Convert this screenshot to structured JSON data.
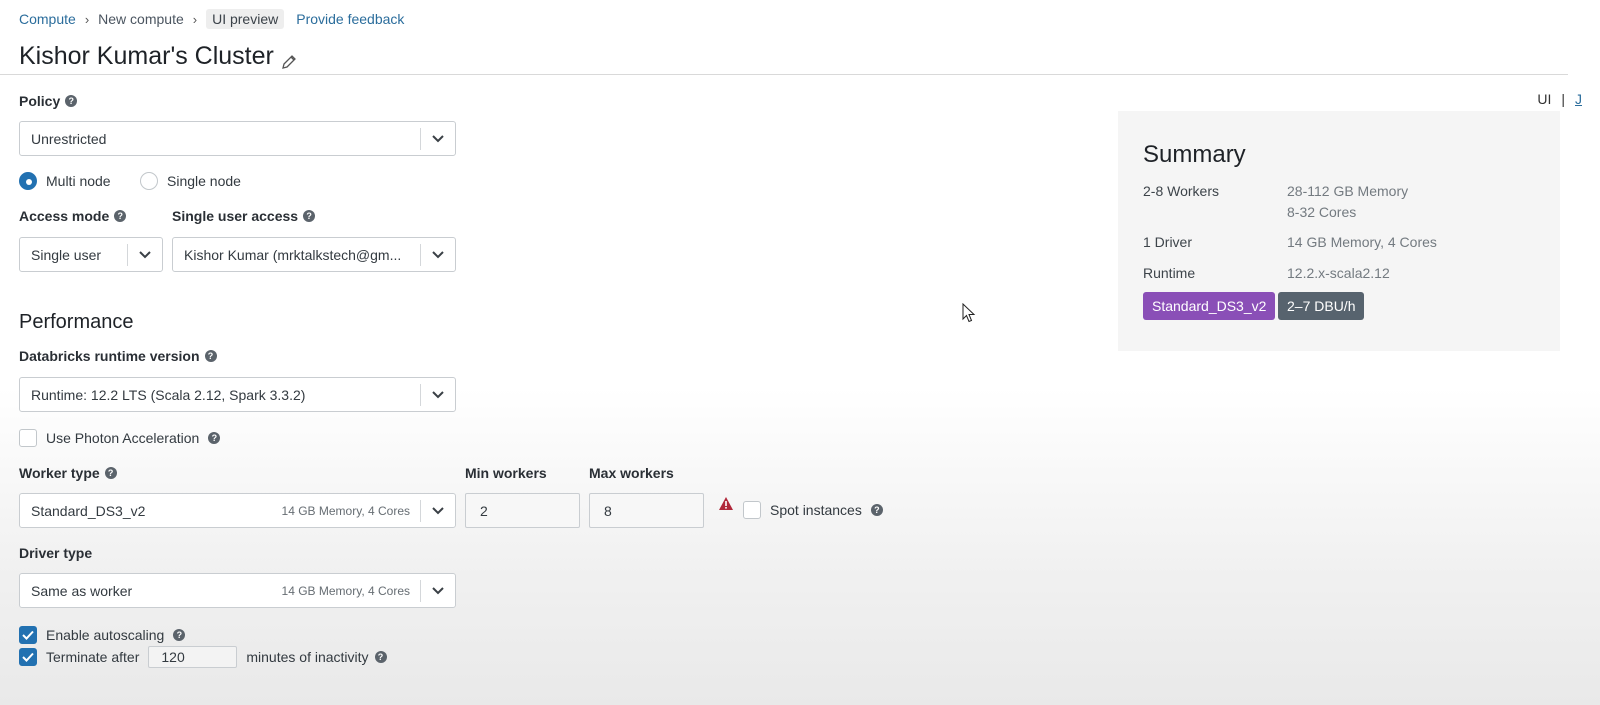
{
  "breadcrumb": {
    "items": [
      "Compute",
      "New compute"
    ],
    "preview_badge": "UI preview",
    "feedback_link": "Provide feedback"
  },
  "page_title": "Kishor Kumar's Cluster",
  "view_toggle": {
    "ui": "UI",
    "separator": "|",
    "json": "J"
  },
  "policy": {
    "label": "Policy",
    "value": "Unrestricted"
  },
  "node_mode": {
    "multi": "Multi node",
    "single": "Single node",
    "selected": "multi"
  },
  "access_mode": {
    "label": "Access mode",
    "value": "Single user"
  },
  "single_user_access": {
    "label": "Single user access",
    "value": "Kishor Kumar (mrktalkstech@gm..."
  },
  "performance": {
    "heading": "Performance",
    "runtime_label": "Databricks runtime version",
    "runtime_value": "Runtime: 12.2 LTS (Scala 2.12, Spark 3.3.2)",
    "photon_label": "Use Photon Acceleration",
    "photon_checked": false
  },
  "worker": {
    "label": "Worker type",
    "value": "Standard_DS3_v2",
    "meta": "14 GB Memory, 4 Cores",
    "min_label": "Min workers",
    "min_value": "2",
    "max_label": "Max workers",
    "max_value": "8",
    "spot_label": "Spot instances",
    "spot_checked": false
  },
  "driver": {
    "label": "Driver type",
    "value": "Same as worker",
    "meta": "14 GB Memory, 4 Cores"
  },
  "autoscaling": {
    "label": "Enable autoscaling",
    "checked": true
  },
  "terminate": {
    "label": "Terminate after",
    "value": "120",
    "suffix": "minutes of inactivity",
    "checked": true
  },
  "summary": {
    "title": "Summary",
    "rows": [
      {
        "key": "2-8 Workers",
        "value": "28-112 GB Memory",
        "value2": "8-32 Cores"
      },
      {
        "key": "1 Driver",
        "value": "14 GB Memory, 4 Cores"
      },
      {
        "key": "Runtime",
        "value": "12.2.x-scala2.12"
      }
    ],
    "chips": [
      {
        "label": "Standard_DS3_v2",
        "color": "#8a4fb7"
      },
      {
        "label": "2–7 DBU/h",
        "color": "#57636e"
      }
    ]
  },
  "colors": {
    "accent": "#2271b1",
    "link": "#2b6d9c",
    "warning": "#c0392b"
  }
}
